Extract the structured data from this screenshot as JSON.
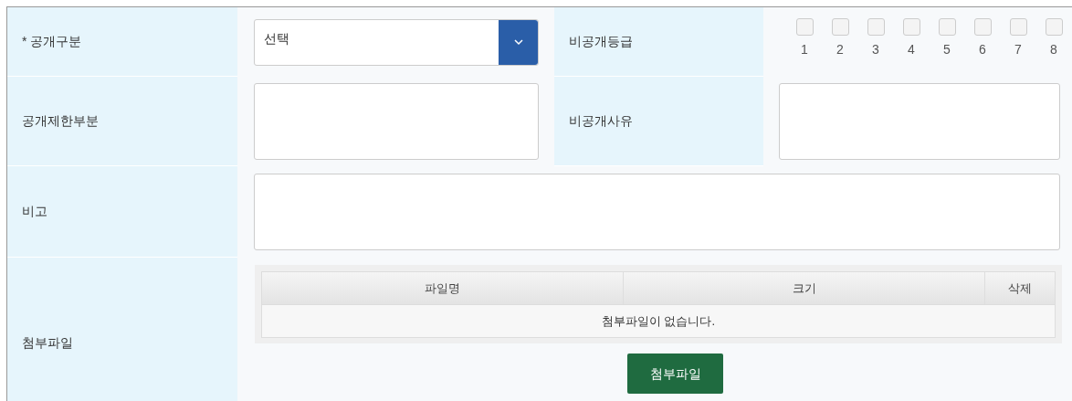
{
  "fields": {
    "disclosure_type": {
      "label": "* 공개구분",
      "value": "선택"
    },
    "nondisclosure_grade": {
      "label": "비공개등급",
      "options": [
        {
          "label": "1",
          "checked": false
        },
        {
          "label": "2",
          "checked": false
        },
        {
          "label": "3",
          "checked": false
        },
        {
          "label": "4",
          "checked": false
        },
        {
          "label": "5",
          "checked": false
        },
        {
          "label": "6",
          "checked": false
        },
        {
          "label": "7",
          "checked": false
        },
        {
          "label": "8",
          "checked": false
        }
      ]
    },
    "restricted_part": {
      "label": "공개제한부분"
    },
    "nondisclosure_reason": {
      "label": "비공개사유"
    },
    "remarks": {
      "label": "비고"
    },
    "attachments": {
      "label": "첨부파일",
      "columns": [
        "파일명",
        "크기",
        "삭제"
      ],
      "empty_message": "첨부파일이 없습니다.",
      "button": "첨부파일"
    }
  }
}
